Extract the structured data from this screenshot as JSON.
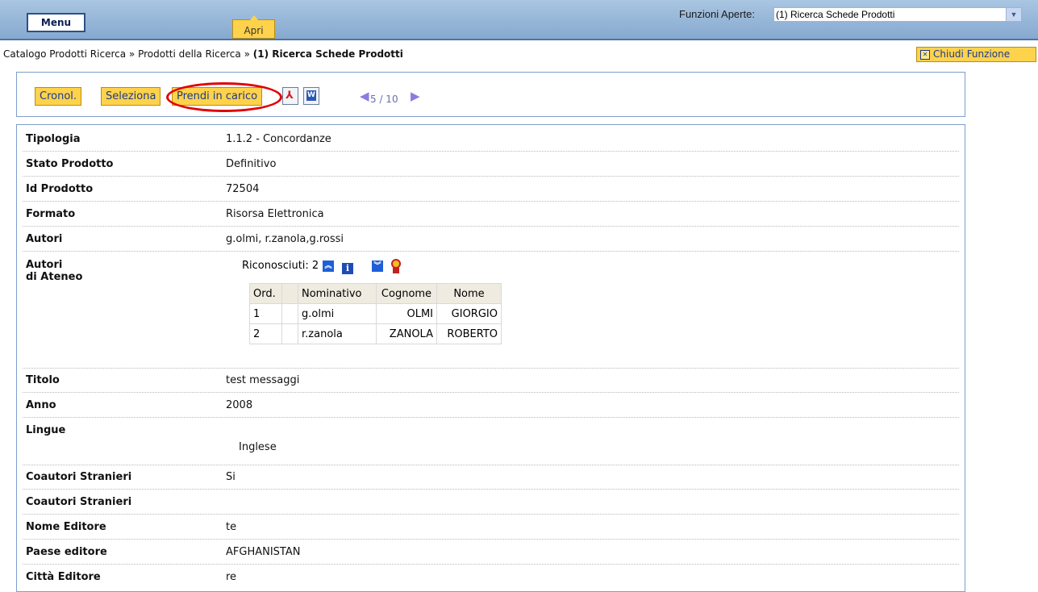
{
  "topbar": {
    "menu_label": "Menu",
    "apri_label": "Apri",
    "funzioni_label": "Funzioni Aperte:",
    "funzioni_selected": "(1) Ricerca Schede Prodotti"
  },
  "breadcrumb": {
    "part1": "Catalogo Prodotti Ricerca",
    "sep": "»",
    "part2": "Prodotti della Ricerca",
    "current": "(1) Ricerca Schede Prodotti"
  },
  "chiudi_label": "Chiudi Funzione",
  "toolbar": {
    "cronol_label": "Cronol.",
    "seleziona_label": "Seleziona",
    "prendi_label": "Prendi in carico",
    "pager_text": "5 / 10"
  },
  "fields": {
    "tipologia": {
      "label": "Tipologia",
      "value": "1.1.2 - Concordanze"
    },
    "stato": {
      "label": "Stato Prodotto",
      "value": "Definitivo"
    },
    "id": {
      "label": "Id Prodotto",
      "value": "72504"
    },
    "formato": {
      "label": "Formato",
      "value": "Risorsa Elettronica"
    },
    "autori": {
      "label": "Autori",
      "value": "g.olmi, r.zanola,g.rossi"
    },
    "autori_ateneo": {
      "label_line1": "Autori",
      "label_line2": "di Ateneo",
      "riconosciuti": "Riconosciuti: 2"
    },
    "titolo": {
      "label": "Titolo",
      "value": "test messaggi"
    },
    "anno": {
      "label": "Anno",
      "value": "2008"
    },
    "lingue": {
      "label": "Lingue",
      "value": "Inglese"
    },
    "coautori1": {
      "label": "Coautori Stranieri",
      "value": "Si"
    },
    "coautori2": {
      "label": "Coautori Stranieri",
      "value": ""
    },
    "editore": {
      "label": "Nome Editore",
      "value": "te"
    },
    "paese": {
      "label": "Paese editore",
      "value": "AFGHANISTAN"
    },
    "citta": {
      "label": "Città Editore",
      "value": "re"
    }
  },
  "authors_table": {
    "headers": [
      "Ord.",
      "",
      "Nominativo",
      "Cognome",
      "Nome"
    ],
    "rows": [
      [
        "1",
        "",
        "g.olmi",
        "OLMI",
        "GIORGIO"
      ],
      [
        "2",
        "",
        "r.zanola",
        "ZANOLA",
        "ROBERTO"
      ]
    ]
  },
  "colors": {
    "accent_yellow": "#ffd24c",
    "topbar_blue": "#9ab9dc",
    "panel_border": "#7d9ec9",
    "highlight_red": "#e00000"
  },
  "icons": [
    "pdf-icon",
    "word-icon",
    "arrow-left-icon",
    "arrow-right-icon",
    "expand-up-icon",
    "info-icon",
    "expand-down-icon",
    "award-icon",
    "close-box-icon",
    "dropdown-arrow-icon"
  ]
}
